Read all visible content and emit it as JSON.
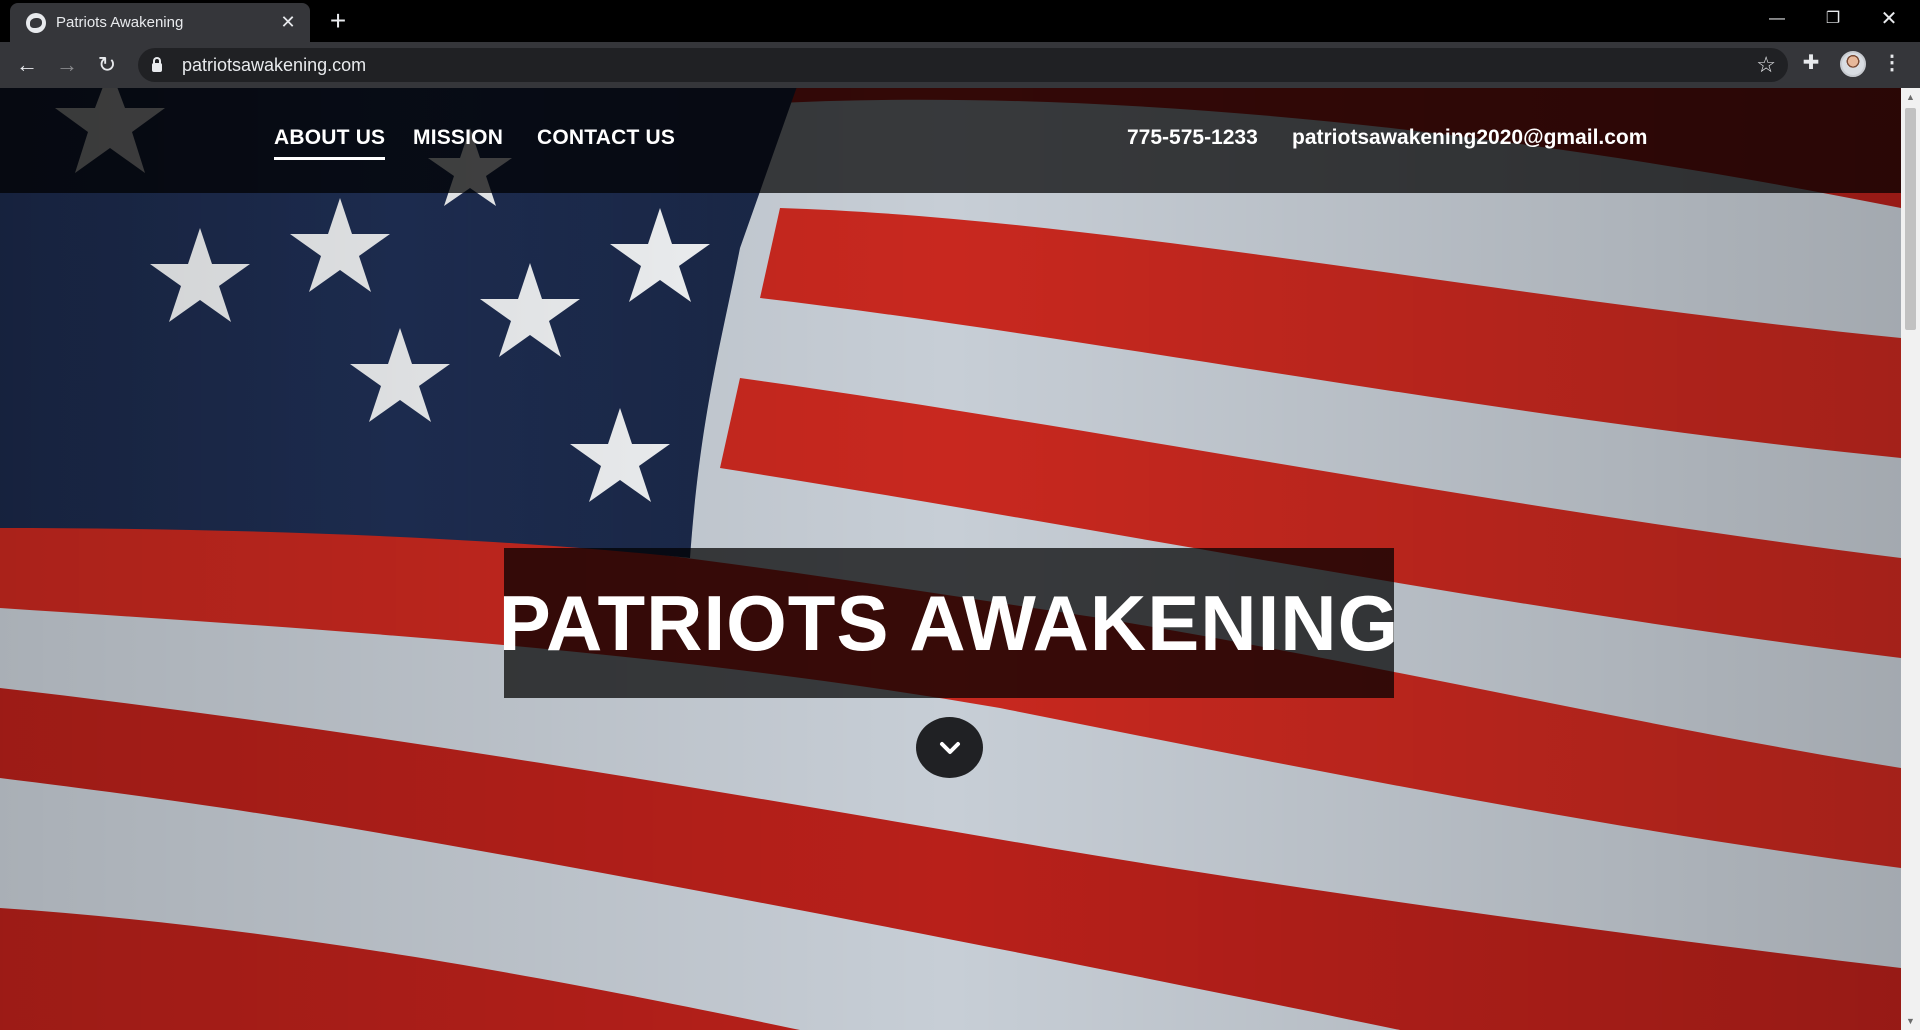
{
  "browser": {
    "tab_title": "Patriots Awakening",
    "tab_close": "✕",
    "new_tab": "+",
    "url": "patriotsawakening.com",
    "icons": [
      "globe-icon",
      "back-icon",
      "forward-icon",
      "reload-icon",
      "lock-icon",
      "star-icon",
      "extensions-icon",
      "profile-avatar",
      "menu-icon",
      "minimize-icon",
      "restore-icon",
      "close-icon"
    ]
  },
  "site": {
    "nav": [
      {
        "label": "ABOUT US",
        "active": true
      },
      {
        "label": "MISSION",
        "active": false
      },
      {
        "label": "CONTACT US",
        "active": false
      }
    ],
    "phone": "775-575-1233",
    "email": "patriotsawakening2020@gmail.com",
    "hero_title": "PATRIOTS AWAKENING",
    "scroll_icon": "chevron-down-icon"
  },
  "colors": {
    "chrome_dark": "#000000",
    "chrome_toolbar": "#35363a",
    "omnibox": "#202124",
    "flag_red": "#c8281f",
    "flag_white": "#c7ced6",
    "flag_blue": "#1f2f55",
    "overlay": "#000000"
  }
}
